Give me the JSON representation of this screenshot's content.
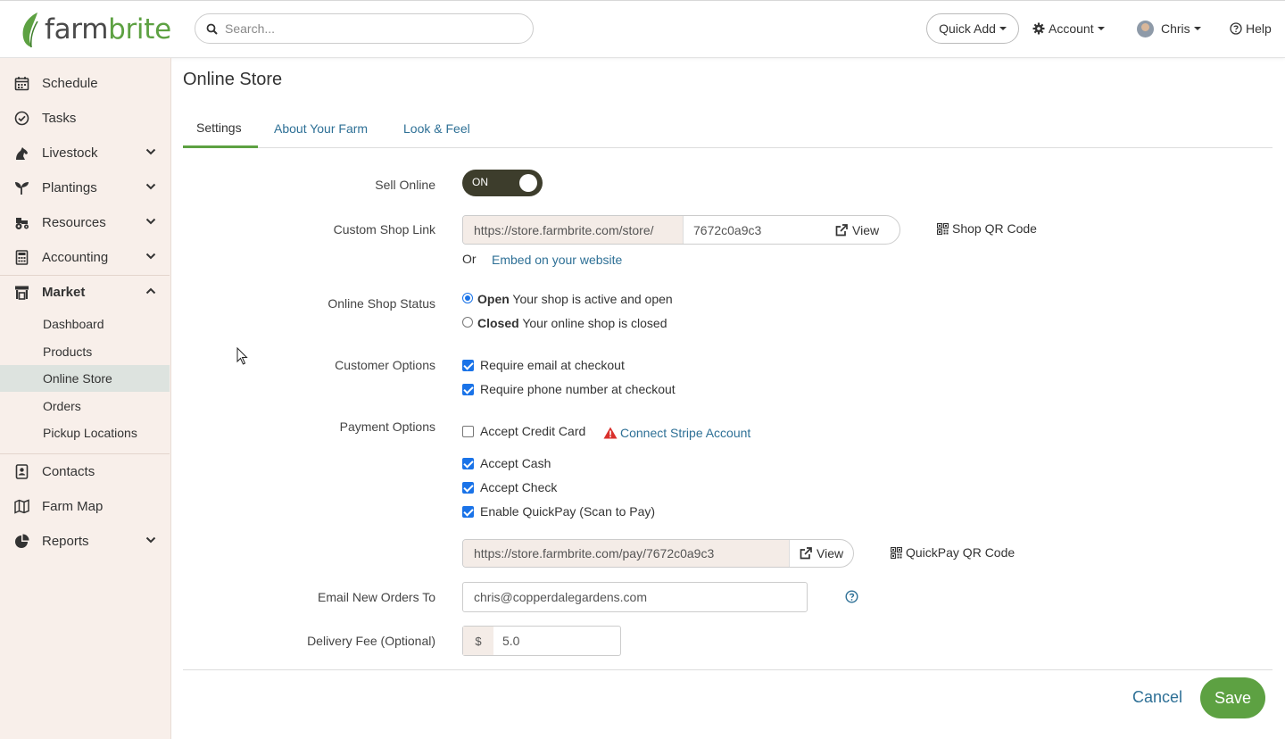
{
  "brand": {
    "name_part1": "farm",
    "name_part2": "brite"
  },
  "topbar": {
    "search_placeholder": "Search...",
    "quick_add": "Quick Add",
    "account": "Account",
    "user": "Chris",
    "help": "Help"
  },
  "sidebar": {
    "items": [
      {
        "label": "Schedule",
        "icon": "calendar-icon"
      },
      {
        "label": "Tasks",
        "icon": "check-circle-icon"
      },
      {
        "label": "Livestock",
        "icon": "horse-icon"
      },
      {
        "label": "Plantings",
        "icon": "seedling-icon"
      },
      {
        "label": "Resources",
        "icon": "tractor-icon"
      },
      {
        "label": "Accounting",
        "icon": "calculator-icon"
      },
      {
        "label": "Market",
        "icon": "store-icon"
      },
      {
        "label": "Contacts",
        "icon": "contact-card-icon"
      },
      {
        "label": "Farm Map",
        "icon": "map-icon"
      },
      {
        "label": "Reports",
        "icon": "pie-chart-icon"
      }
    ],
    "market_sub": [
      "Dashboard",
      "Products",
      "Online Store",
      "Orders",
      "Pickup Locations"
    ],
    "active_sub": "Online Store"
  },
  "page": {
    "title": "Online Store",
    "tabs": [
      "Settings",
      "About Your Farm",
      "Look & Feel"
    ],
    "active_tab": "Settings"
  },
  "form": {
    "sell_online": {
      "label": "Sell Online",
      "toggle_text": "ON"
    },
    "shop_link": {
      "label": "Custom Shop Link",
      "prefix": "https://store.farmbrite.com/store/",
      "slug": "7672c0a9c3",
      "view": "View",
      "qr": "Shop QR Code",
      "or": "Or",
      "embed": "Embed on your website"
    },
    "status": {
      "label": "Online Shop Status",
      "open_bold": "Open",
      "open_text": "Your shop is active and open",
      "closed_bold": "Closed",
      "closed_text": "Your online shop is closed"
    },
    "customer": {
      "label": "Customer Options",
      "email": "Require email at checkout",
      "phone": "Require phone number at checkout"
    },
    "payment": {
      "label": "Payment Options",
      "credit": "Accept Credit Card",
      "stripe": "Connect Stripe Account",
      "cash": "Accept Cash",
      "check": "Accept Check",
      "quickpay": "Enable QuickPay (Scan to Pay)",
      "pay_url": "https://store.farmbrite.com/pay/7672c0a9c3",
      "pay_view": "View",
      "pay_qr": "QuickPay QR Code"
    },
    "email_orders": {
      "label": "Email New Orders To",
      "value": "chris@copperdalegardens.com"
    },
    "delivery_fee": {
      "label": "Delivery Fee (Optional)",
      "currency": "$",
      "value": "5.0"
    }
  },
  "footer": {
    "cancel": "Cancel",
    "save": "Save"
  },
  "colors": {
    "brand_green": "#5da142",
    "link_blue": "#2e7096",
    "sidebar_bg": "#f8efea",
    "toggle_bg": "#3d3d2c",
    "warning_red": "#d9302c"
  }
}
